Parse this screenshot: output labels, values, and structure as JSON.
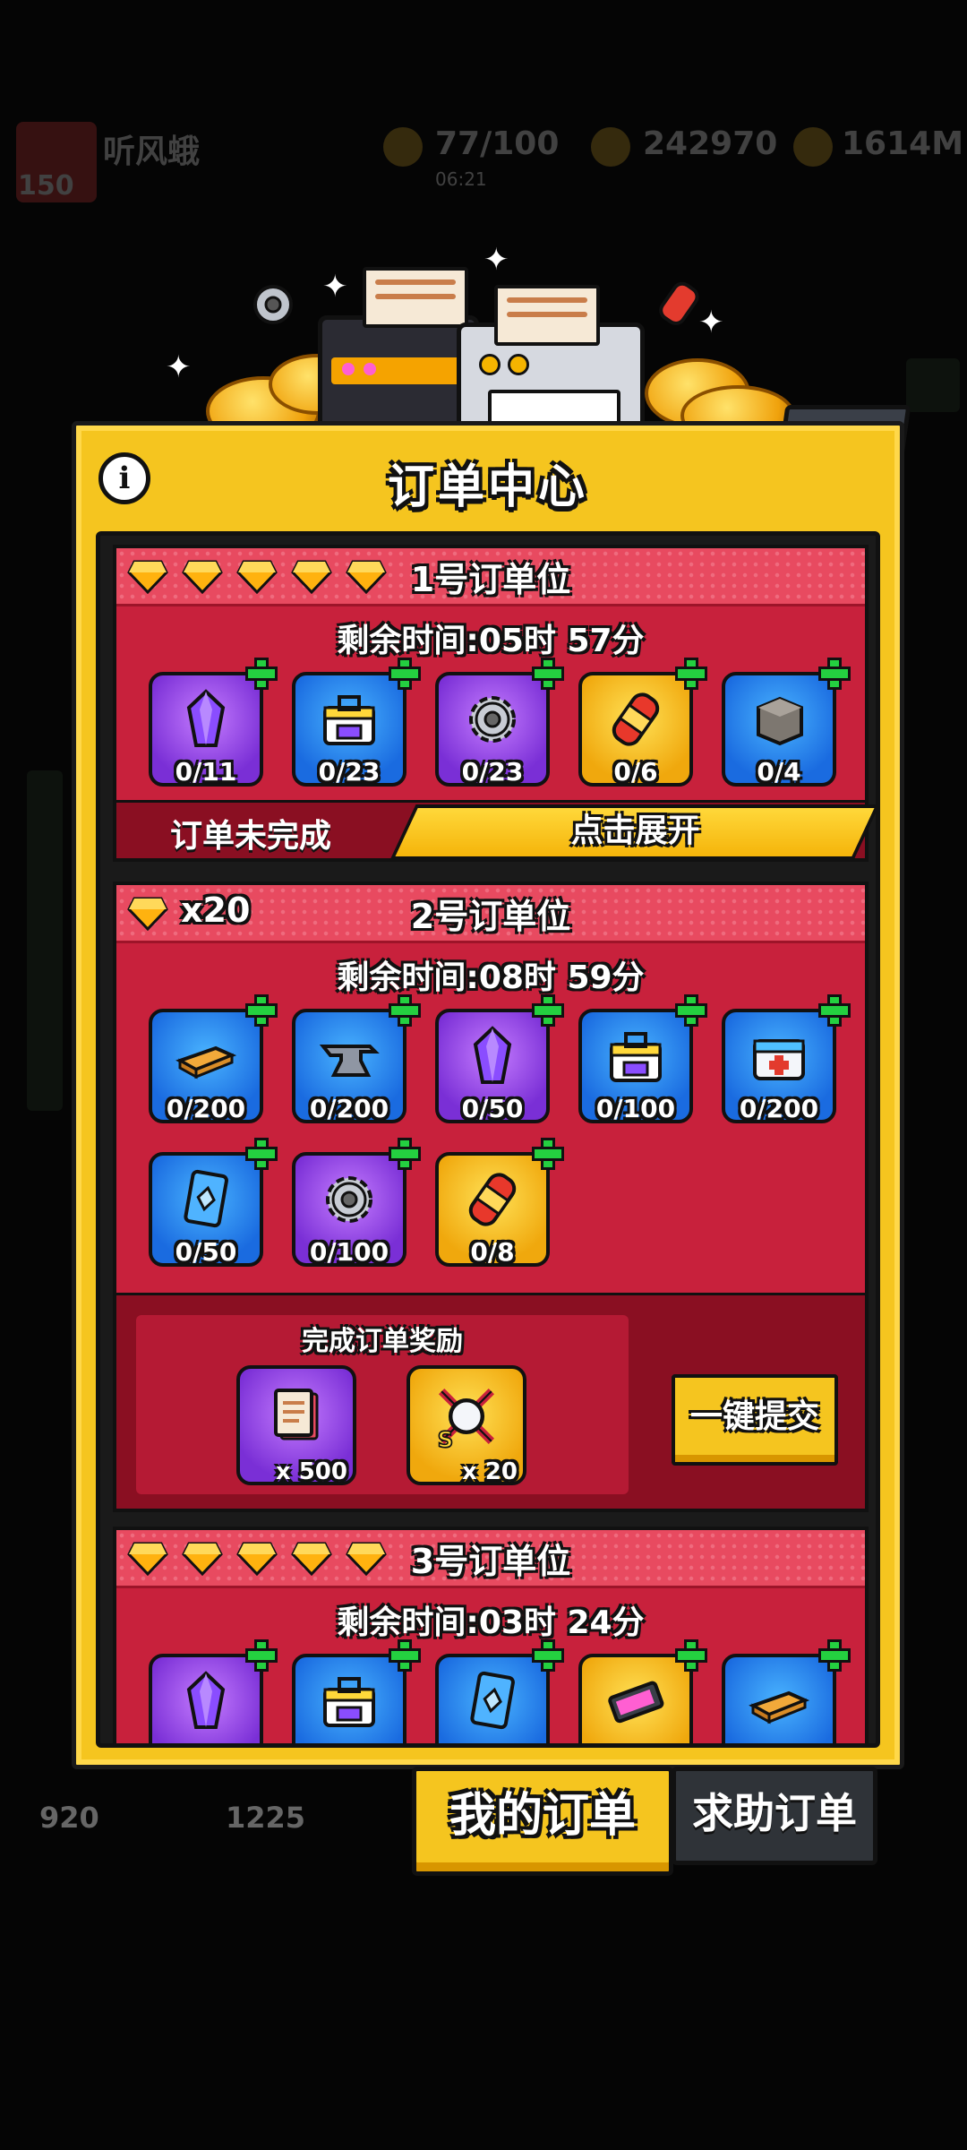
{
  "background_hud": {
    "player_name": "听风蛾",
    "player_level": "150",
    "energy": "77/100",
    "energy_timer": "06:21",
    "currency_1": "242970",
    "currency_2": "1614M",
    "bottom_left_value": "920",
    "bottom_mid_value": "1225"
  },
  "panel": {
    "title": "订单中心",
    "info_icon": "info-icon",
    "close_icon": "close-icon"
  },
  "orders": [
    {
      "title": "1号订单位",
      "gems_shown": 5,
      "timer": "剩余时间:05时 57分",
      "items": [
        {
          "icon": "crystal-icon",
          "color": "purple",
          "count": "0/11"
        },
        {
          "icon": "toolbox-icon",
          "color": "blue",
          "count": "0/23"
        },
        {
          "icon": "gear-icon",
          "color": "purple",
          "count": "0/23"
        },
        {
          "icon": "capsule-icon",
          "color": "yellow",
          "count": "0/6"
        },
        {
          "icon": "stone-block-icon",
          "color": "blue",
          "count": "0/4"
        }
      ],
      "status": "订单未完成",
      "expand_label": "点击展开"
    },
    {
      "title": "2号订单位",
      "gem_count": "x20",
      "timer": "剩余时间:08时 59分",
      "items": [
        {
          "icon": "wood-plank-icon",
          "color": "blue",
          "count": "0/200"
        },
        {
          "icon": "anvil-icon",
          "color": "blue",
          "count": "0/200"
        },
        {
          "icon": "crystal-icon",
          "color": "purple",
          "count": "0/50"
        },
        {
          "icon": "toolbox-icon",
          "color": "blue",
          "count": "0/100"
        },
        {
          "icon": "medkit-icon",
          "color": "blue",
          "count": "0/200"
        },
        {
          "icon": "card-icon",
          "color": "blue",
          "count": "0/50"
        },
        {
          "icon": "gear-icon",
          "color": "purple",
          "count": "0/100"
        },
        {
          "icon": "capsule-icon",
          "color": "yellow",
          "count": "0/8"
        }
      ],
      "reward_title": "完成订单奖励",
      "rewards": [
        {
          "icon": "scroll-icon",
          "color": "purple",
          "count": "x 500"
        },
        {
          "icon": "s-emblem-icon",
          "color": "yellow",
          "count": "x 20"
        }
      ],
      "submit_label": "一键提交"
    },
    {
      "title": "3号订单位",
      "gems_shown": 5,
      "timer": "剩余时间:03时 24分",
      "items": [
        {
          "icon": "crystal-icon",
          "color": "purple"
        },
        {
          "icon": "toolbox-icon",
          "color": "blue"
        },
        {
          "icon": "card-icon",
          "color": "blue"
        },
        {
          "icon": "battery-icon",
          "color": "yellow"
        },
        {
          "icon": "wood-plank-icon",
          "color": "blue"
        }
      ]
    }
  ],
  "tabs": [
    {
      "label": "我的订单",
      "active": true
    },
    {
      "label": "求助订单",
      "active": false
    }
  ],
  "colors": {
    "panel_yellow": "#f5c51f",
    "card_red": "#c8213c",
    "plus_green": "#24d040"
  }
}
